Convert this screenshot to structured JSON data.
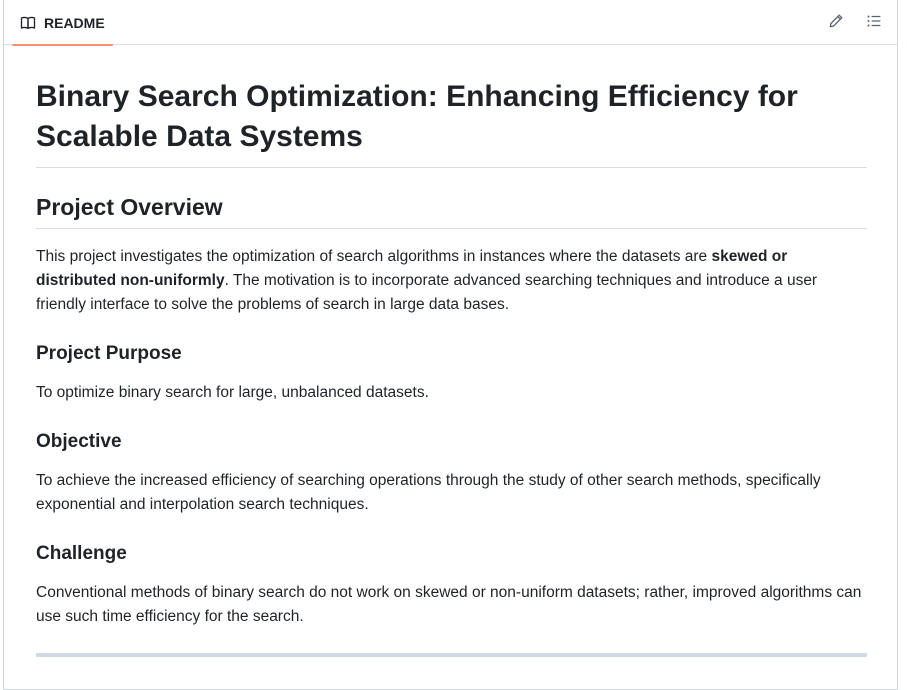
{
  "tab": {
    "label": "README",
    "icon": "book-icon"
  },
  "actions": {
    "edit_icon": "pencil-icon",
    "outline_icon": "list-unordered-icon"
  },
  "readme": {
    "title": "Binary Search Optimization: Enhancing Efficiency for Scalable Data Systems",
    "overview_heading": "Project Overview",
    "overview_pre": "This project investigates the optimization of search algorithms in instances where the datasets are ",
    "overview_bold": "skewed or distributed non-uniformly",
    "overview_post": ". The motivation is to incorporate advanced searching techniques and introduce a user friendly interface to solve the problems of search in large data bases.",
    "purpose_heading": "Project Purpose",
    "purpose_text": "To optimize binary search for large, unbalanced datasets.",
    "objective_heading": "Objective",
    "objective_text": "To achieve the increased efficiency of searching operations through the study of other search methods, specifically exponential and interpolation search techniques.",
    "challenge_heading": "Challenge",
    "challenge_text": "Conventional methods of binary search do not work on skewed or non-uniform datasets; rather, improved algorithms can use such time efficiency for the search."
  },
  "colors": {
    "tab_underline": "#fd8c73",
    "text": "#1f2328",
    "border": "#d8dee4",
    "icon": "#59636e"
  }
}
